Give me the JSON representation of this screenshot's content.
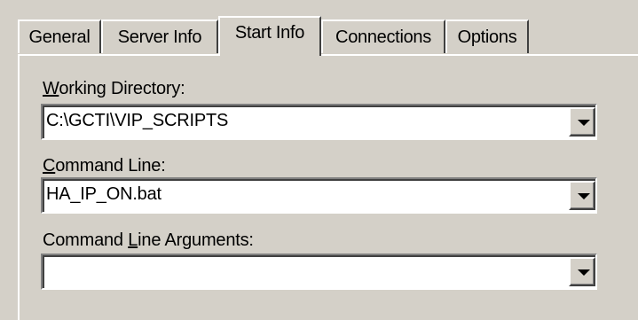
{
  "tabs": [
    {
      "label": "General",
      "active": false
    },
    {
      "label": "Server Info",
      "active": false
    },
    {
      "label": "Start Info",
      "active": true
    },
    {
      "label": "Connections",
      "active": false
    },
    {
      "label": "Options",
      "active": false
    }
  ],
  "fields": {
    "working_directory": {
      "label": "Working Directory:",
      "mnemonic": "W",
      "value": "C:\\GCTI\\VIP_SCRIPTS"
    },
    "command_line": {
      "label": "Command Line:",
      "mnemonic": "C",
      "value": "HA_IP_ON.bat"
    },
    "command_line_arguments": {
      "label": "Command Line Arguments:",
      "mnemonic": "L",
      "value": ""
    }
  },
  "icons": {
    "dropdown": "chevron-down-icon"
  }
}
